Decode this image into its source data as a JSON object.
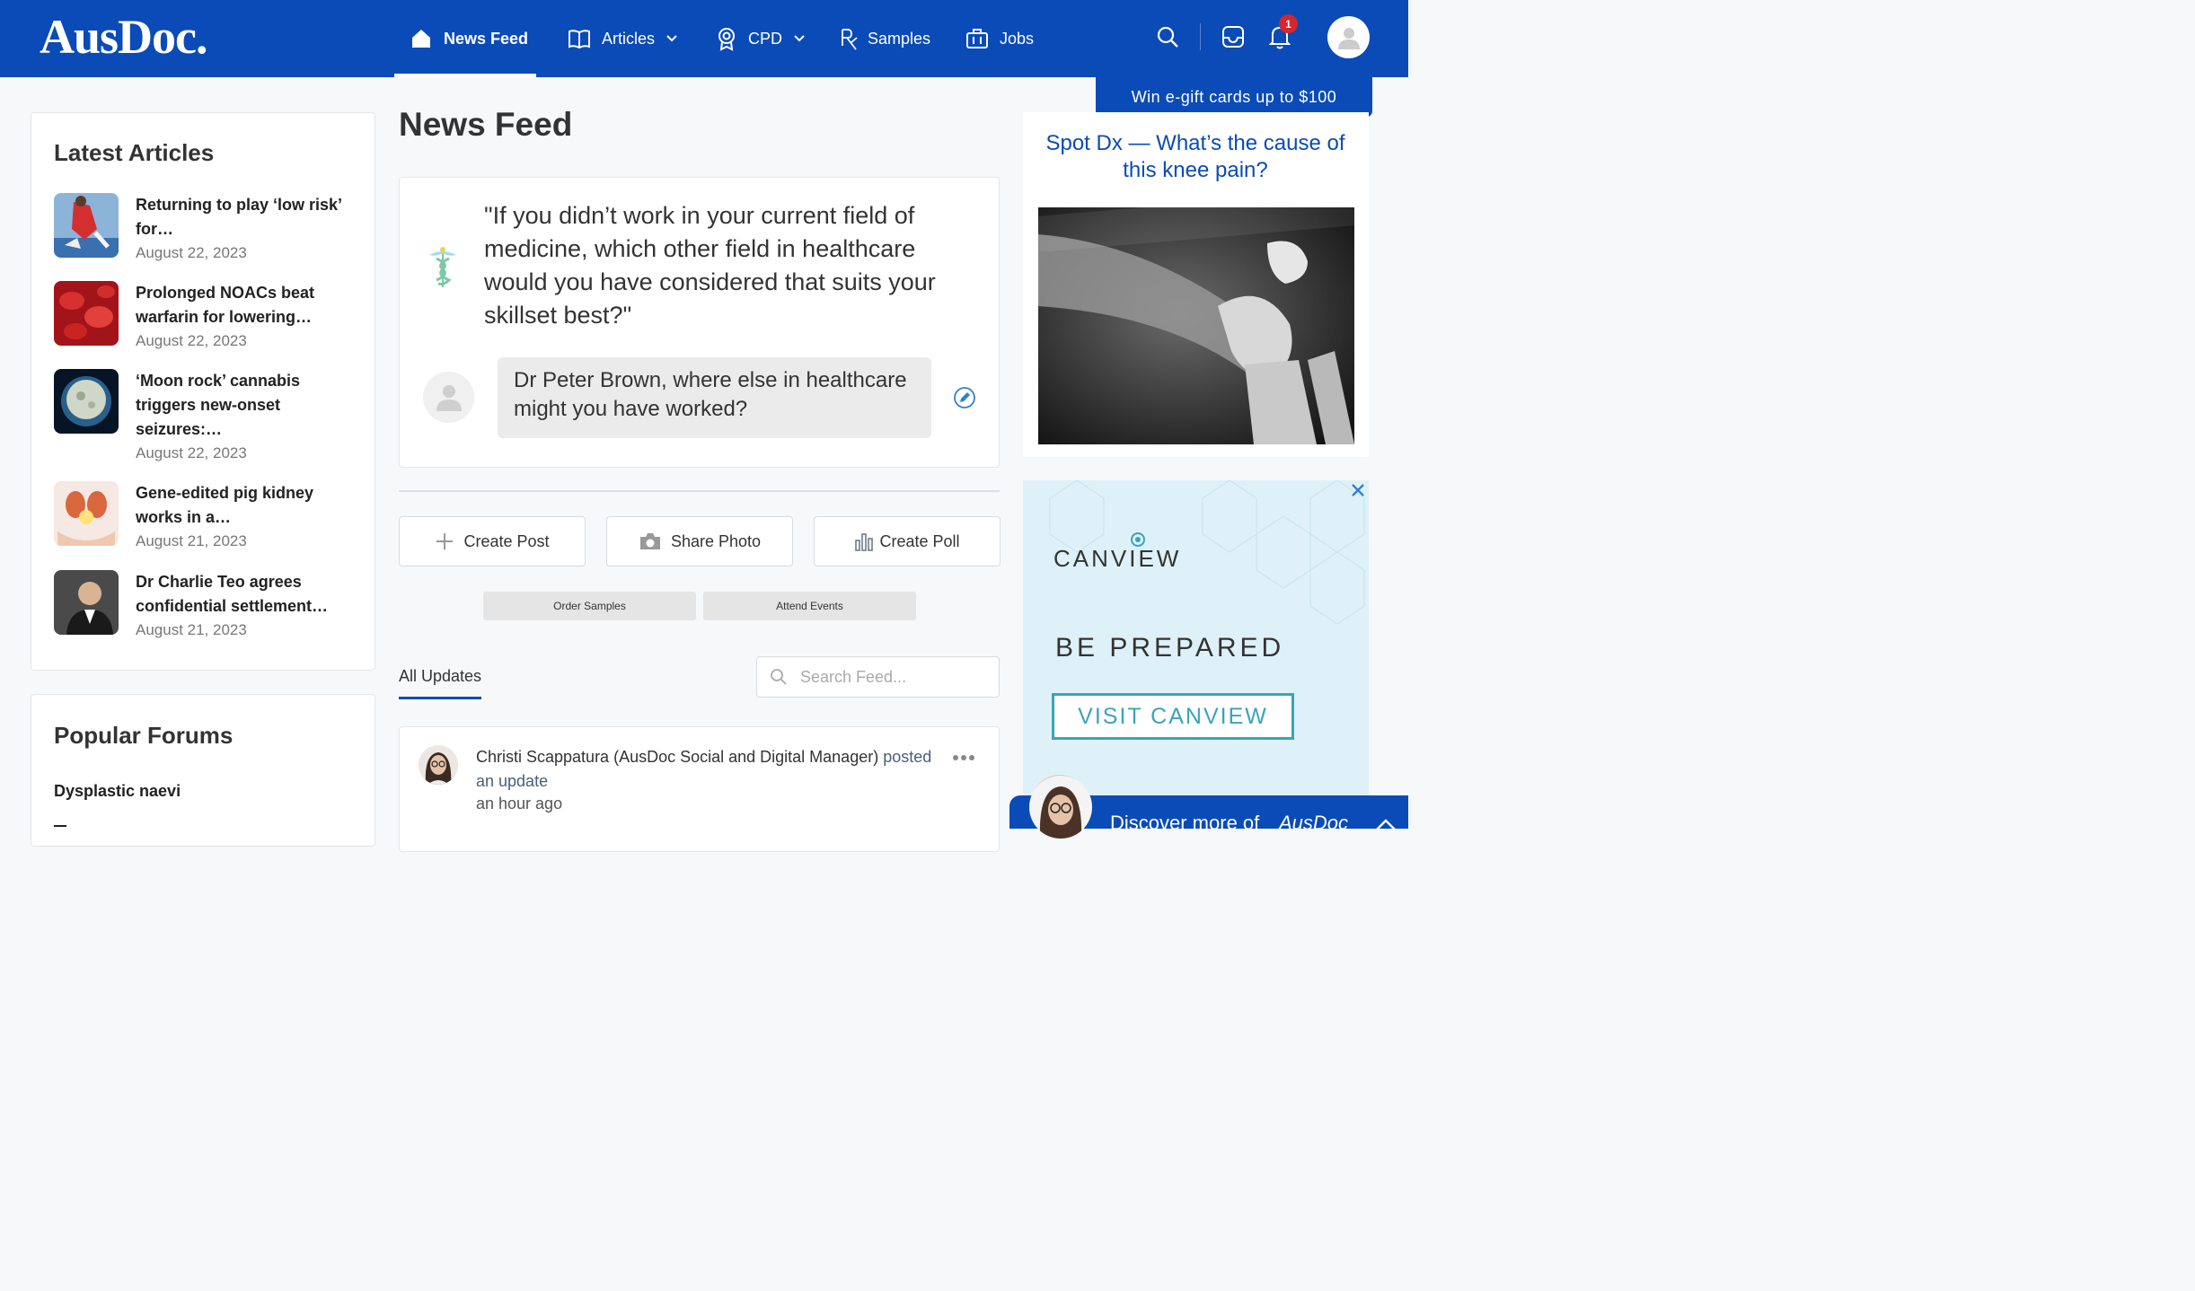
{
  "header": {
    "logo": "AusDoc.",
    "nav": [
      {
        "label": "News Feed",
        "icon": "home-icon",
        "active": true
      },
      {
        "label": "Articles",
        "icon": "book-icon",
        "dropdown": true
      },
      {
        "label": "CPD",
        "icon": "award-icon",
        "dropdown": true
      },
      {
        "label": "Samples",
        "icon": "rx-icon"
      },
      {
        "label": "Jobs",
        "icon": "briefcase-icon"
      }
    ],
    "notification_count": "1"
  },
  "sidebar": {
    "latest_title": "Latest Articles",
    "articles": [
      {
        "title": "Returning to play ‘low risk’ for…",
        "date": "August 22, 2023"
      },
      {
        "title": "Prolonged NOACs beat warfarin for lowering…",
        "date": "August 22, 2023"
      },
      {
        "title": "‘Moon rock’ cannabis triggers new-onset seizures:…",
        "date": "August 22, 2023"
      },
      {
        "title": "Gene-edited pig kidney works in a…",
        "date": "August 21, 2023"
      },
      {
        "title": "Dr Charlie Teo agrees confidential settlement…",
        "date": "August 21, 2023"
      }
    ],
    "forums_title": "Popular Forums",
    "forums": [
      "Dysplastic naevi"
    ]
  },
  "main": {
    "title": "News Feed",
    "question": "\"If you didn’t work in your current field of medicine, which other field in healthcare would you have considered that suits your skillset best?\"",
    "reply_prompt": "Dr Peter Brown, where else in healthcare might you have worked?",
    "actions": {
      "create_post": "Create Post",
      "share_photo": "Share Photo",
      "create_poll": "Create Poll"
    },
    "quick_links": {
      "order_samples": "Order Samples",
      "attend_events": "Attend Events"
    },
    "tab_all_updates": "All Updates",
    "search_placeholder": "Search Feed...",
    "feed": [
      {
        "author": "Christi Scappatura (AusDoc Social and Digital Manager)",
        "action": "posted an update",
        "time": "an hour ago"
      }
    ]
  },
  "right": {
    "promo_tab": "Win e-gift cards up to $100",
    "spot_dx": "Spot Dx — What’s the cause of this knee pain?",
    "ad": {
      "brand": "CANVIEW",
      "headline": "BE PREPARED",
      "cta": "VISIT CANVIEW"
    },
    "discover": "Discover more of",
    "discover_brand": "AusDoc"
  },
  "colors": {
    "brand": "#0a4bb8",
    "badge": "#d6262b"
  }
}
